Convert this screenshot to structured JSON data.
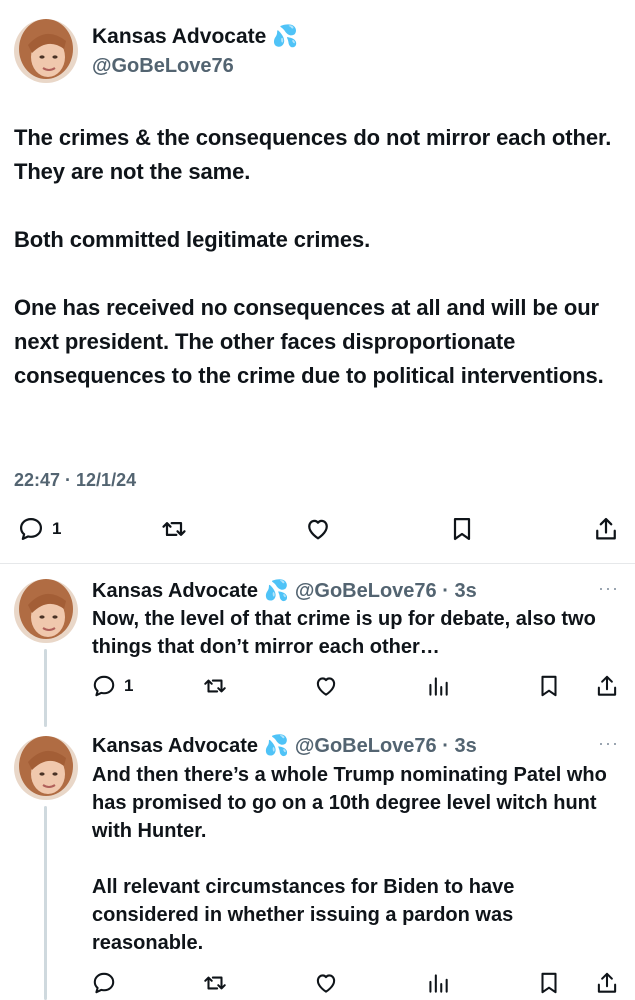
{
  "main_tweet": {
    "display_name": "Kansas Advocate",
    "badge_emoji": "💦",
    "handle": "@GoBeLove76",
    "paragraphs": [
      "The crimes & the consequences do not mirror each other.  They are not the same.",
      "Both committed legitimate crimes.",
      "One has received no consequences at all and will be our next president. The other faces disproportionate consequences to the crime due to political interventions."
    ],
    "timestamp": "22:47 · 12/1/24",
    "actions": {
      "reply_count": "1",
      "reply_icon": "reply-icon",
      "retweet_icon": "retweet-icon",
      "like_icon": "heart-icon",
      "bookmark_icon": "bookmark-icon",
      "share_icon": "share-icon"
    }
  },
  "replies": [
    {
      "display_name": "Kansas Advocate",
      "badge_emoji": "💦",
      "handle_time": "@GoBeLove76 · 3s",
      "more": "···",
      "paragraphs": [
        "Now, the level of that crime is up for debate, also two things that don’t mirror each other…"
      ],
      "reply_count": "1"
    },
    {
      "display_name": "Kansas Advocate",
      "badge_emoji": "💦",
      "handle_time": "@GoBeLove76 · 3s",
      "more": "···",
      "paragraphs": [
        "And then there’s a whole Trump nominating Patel who has promised to go on a 10th degree level witch hunt with Hunter.",
        "All relevant circumstances for Biden to have considered in whether issuing a pardon was reasonable."
      ],
      "reply_count": ""
    }
  ],
  "colors": {
    "text": "#0f1419",
    "secondary": "#536471",
    "divider": "#e6e8ea",
    "thread_line": "#cfd9de"
  }
}
